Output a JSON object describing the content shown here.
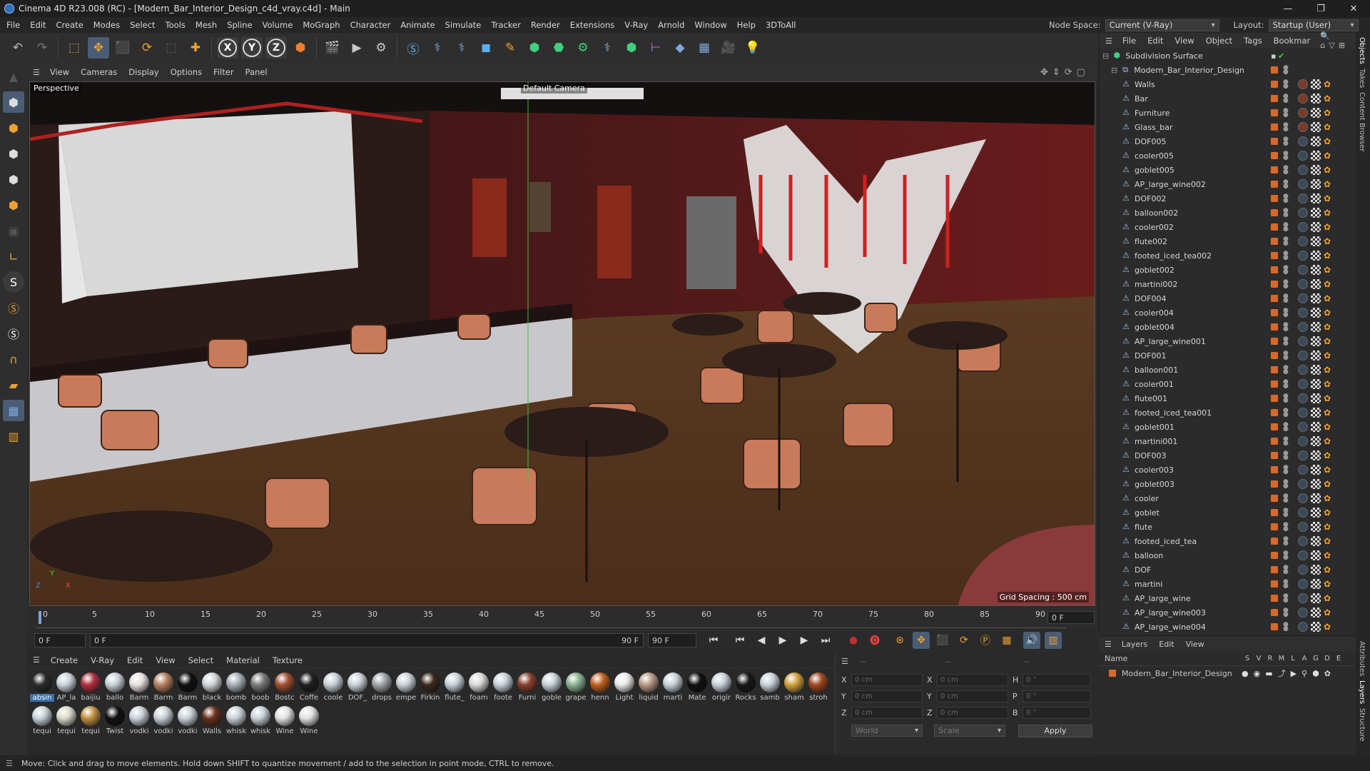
{
  "window": {
    "title": "Cinema 4D R23.008 (RC) - [Modern_Bar_Interior_Design_c4d_vray.c4d] - Main",
    "controls": [
      "—",
      "❐",
      "✕"
    ]
  },
  "menubar": {
    "items": [
      "File",
      "Edit",
      "Create",
      "Modes",
      "Select",
      "Tools",
      "Mesh",
      "Spline",
      "Volume",
      "MoGraph",
      "Character",
      "Animate",
      "Simulate",
      "Tracker",
      "Render",
      "Extensions",
      "V-Ray",
      "Arnold",
      "Window",
      "Help",
      "3DToAll"
    ],
    "node_space_label": "Node Space:",
    "node_space_value": "Current (V-Ray)",
    "layout_label": "Layout:",
    "layout_value": "Startup (User)"
  },
  "toolbar": {
    "axes": [
      "X",
      "Y",
      "Z"
    ]
  },
  "viewport": {
    "menu": [
      "View",
      "Cameras",
      "Display",
      "Options",
      "Filter",
      "Panel"
    ],
    "label": "Perspective",
    "camera": "Default Camera",
    "grid_spacing": "Grid Spacing : 500 cm",
    "axis_labels": {
      "y": "Y",
      "z": "Z",
      "x": "X"
    }
  },
  "timeline": {
    "ticks": [
      "0",
      "5",
      "10",
      "15",
      "20",
      "25",
      "30",
      "35",
      "40",
      "45",
      "50",
      "55",
      "60",
      "65",
      "70",
      "75",
      "80",
      "85",
      "90"
    ],
    "frame_right": "0 F"
  },
  "transport": {
    "start": "0 F",
    "current": "0 F",
    "end_a": "90 F",
    "end_b": "90 F"
  },
  "materials": {
    "tabs": [
      "Create",
      "V-Ray",
      "Edit",
      "View",
      "Select",
      "Material",
      "Texture"
    ],
    "row1": [
      {
        "name": "absin",
        "color": "#2b2b2b"
      },
      {
        "name": "AP_la",
        "color": "#c8d0d8"
      },
      {
        "name": "baijiu",
        "color": "#b03040"
      },
      {
        "name": "ballo",
        "color": "#c8d0d8"
      },
      {
        "name": "Barm",
        "color": "#e8e0e0"
      },
      {
        "name": "Barm",
        "color": "#b88060"
      },
      {
        "name": "Barm",
        "color": "#101010"
      },
      {
        "name": "black",
        "color": "#d0d4d8"
      },
      {
        "name": "bomb",
        "color": "#a8b0b8"
      },
      {
        "name": "boob",
        "color": "#7a7a7a"
      },
      {
        "name": "Bostc",
        "color": "#a05030"
      },
      {
        "name": "Coffe",
        "color": "#202020"
      },
      {
        "name": "coole",
        "color": "#c8d0d8"
      },
      {
        "name": "DOF_",
        "color": "#c8d0d8"
      },
      {
        "name": "drops",
        "color": "#a0a4a8"
      },
      {
        "name": "empe",
        "color": "#c8d0d8"
      },
      {
        "name": "Firkin",
        "color": "#3a2a20"
      },
      {
        "name": "flute_",
        "color": "#c8d0d8"
      },
      {
        "name": "foam",
        "color": "#d8d8d8"
      },
      {
        "name": "foote",
        "color": "#c8d0d8"
      },
      {
        "name": "Furni",
        "color": "#8a4030"
      },
      {
        "name": "goble",
        "color": "#c8d0d8"
      },
      {
        "name": "grape",
        "color": "#8ab090"
      },
      {
        "name": "henn",
        "color": "#c06020"
      },
      {
        "name": "Light",
        "color": "#e8e8e8"
      },
      {
        "name": "liquid",
        "color": "#b89888"
      },
      {
        "name": "marti",
        "color": "#c8d0d8"
      },
      {
        "name": "Mate",
        "color": "#101010"
      },
      {
        "name": "origir",
        "color": "#c8d0d8"
      },
      {
        "name": "Rocks",
        "color": "#181818"
      },
      {
        "name": "samb",
        "color": "#c8d0d8"
      },
      {
        "name": "sham",
        "color": "#d0a040"
      },
      {
        "name": "stroh",
        "color": "#a04820"
      }
    ],
    "row2": [
      {
        "name": "tequi",
        "color": "#c8d0d8"
      },
      {
        "name": "tequi",
        "color": "#d8d8c8"
      },
      {
        "name": "tequi",
        "color": "#c09040"
      },
      {
        "name": "Twist",
        "color": "#101010"
      },
      {
        "name": "vodki",
        "color": "#c8d0d8"
      },
      {
        "name": "vodki",
        "color": "#c8d0d8"
      },
      {
        "name": "vodki",
        "color": "#c8d0d8"
      },
      {
        "name": "Walls",
        "color": "#6a3020"
      },
      {
        "name": "whisk",
        "color": "#c8d0d8"
      },
      {
        "name": "whisk",
        "color": "#c8d0d8"
      },
      {
        "name": "Wine",
        "color": "#e0e0e0"
      },
      {
        "name": "Wine",
        "color": "#e0e0e0"
      }
    ]
  },
  "attributes": {
    "dash1": "--",
    "dash2": "--",
    "dash3": "--",
    "rows": [
      {
        "l1": "X",
        "v1": "0 cm",
        "l2": "X",
        "v2": "0 cm",
        "l3": "H",
        "v3": "0 °"
      },
      {
        "l1": "Y",
        "v1": "0 cm",
        "l2": "Y",
        "v2": "0 cm",
        "l3": "P",
        "v3": "0 °"
      },
      {
        "l1": "Z",
        "v1": "0 cm",
        "l2": "Z",
        "v2": "0 cm",
        "l3": "B",
        "v3": "0 °"
      }
    ],
    "coord_system": "World",
    "mode": "Scale",
    "apply": "Apply"
  },
  "objects": {
    "menu": [
      "File",
      "Edit",
      "View",
      "Object",
      "Tags",
      "Bookmar"
    ],
    "root": "Subdivision Surface",
    "group": "Modern_Bar_Interior_Design",
    "items": [
      "Walls",
      "Bar",
      "Furniture",
      "Glass_bar",
      "DOF005",
      "cooler005",
      "goblet005",
      "AP_large_wine002",
      "DOF002",
      "balloon002",
      "cooler002",
      "flute002",
      "footed_iced_tea002",
      "goblet002",
      "martini002",
      "DOF004",
      "cooler004",
      "goblet004",
      "AP_large_wine001",
      "DOF001",
      "balloon001",
      "cooler001",
      "flute001",
      "footed_iced_tea001",
      "goblet001",
      "martini001",
      "DOF003",
      "cooler003",
      "goblet003",
      "cooler",
      "goblet",
      "flute",
      "footed_iced_tea",
      "balloon",
      "DOF",
      "martini",
      "AP_large_wine",
      "AP_large_wine003",
      "AP_large_wine004"
    ]
  },
  "layers": {
    "menu": [
      "Layers",
      "Edit",
      "View"
    ],
    "header_name": "Name",
    "header_flags": [
      "S",
      "V",
      "R",
      "M",
      "L",
      "A",
      "G",
      "D",
      "E"
    ],
    "row": "Modern_Bar_Interior_Design"
  },
  "side_tabs": [
    "Objects",
    "Takes",
    "Content Browser"
  ],
  "side_tabs_lower": [
    "Attributes",
    "Layers",
    "Structure"
  ],
  "status": "Move: Click and drag to move elements. Hold down SHIFT to quantize movement / add to the selection in point mode, CTRL to remove."
}
